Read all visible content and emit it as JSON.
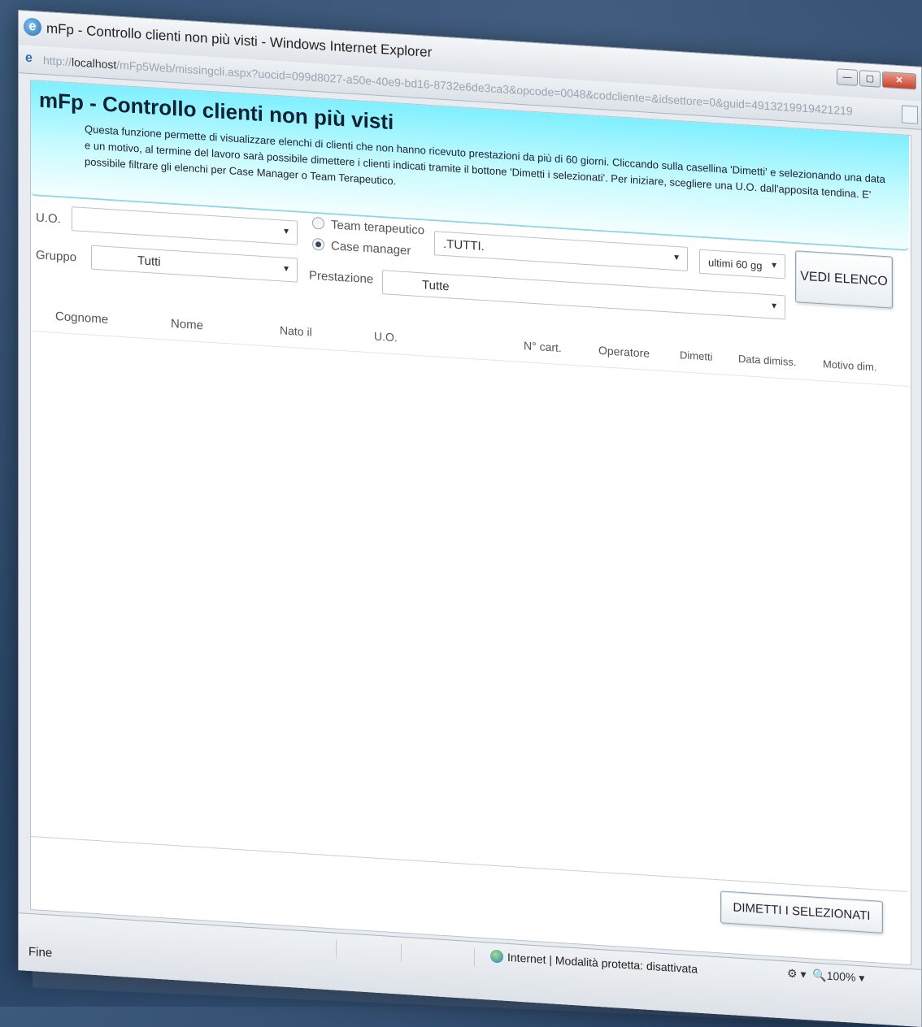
{
  "window": {
    "title": "mFp - Controllo clienti non più visti - Windows Internet Explorer",
    "url_prefix": "http://",
    "url_host": "localhost",
    "url_path": "/mFp5Web/missingcli.aspx?uocid=099d8027-a50e-40e9-bd16-8732e6de3ca3&opcode=0048&codcliente=&idsettore=0&guid=4913219919421219"
  },
  "header": {
    "title": "mFp - Controllo clienti non più visti",
    "description": "Questa funzione permette di visualizzare elenchi di clienti che non hanno ricevuto prestazioni da più di 60 giorni. Cliccando sulla casellina 'Dimetti' e selezionando una data e un motivo, al termine del lavoro sarà possibile dimettere i clienti indicati tramite il bottone 'Dimetti i selezionati'. Per iniziare, scegliere una U.O. dall'apposita tendina. E' possibile filtrare gli elenchi per Case Manager o Team Terapeutico."
  },
  "filters": {
    "uo_label": "U.O.",
    "uo_value": "",
    "gruppo_label": "Gruppo",
    "gruppo_value": "Tutti",
    "radio_team": "Team terapeutico",
    "radio_case": "Case manager",
    "radio_selected": "case_manager",
    "operator_value": ".TUTTI.",
    "prestazione_label": "Prestazione",
    "prestazione_value": "Tutte",
    "period_value": "ultimi 60 gg",
    "vedi_elenco_label": "VEDI ELENCO"
  },
  "grid": {
    "columns": [
      "Cognome",
      "Nome",
      "Nato il",
      "U.O.",
      "N° cart.",
      "Operatore",
      "Dimetti",
      "Data dimiss.",
      "Motivo dim."
    ],
    "rows": []
  },
  "actions": {
    "dimetti_label": "DIMETTI I SELEZIONATI"
  },
  "status": {
    "left": "Fine",
    "zone": "Internet | Modalità protetta: disattivata",
    "zoom": "100%"
  },
  "colors": {
    "header_gradient_top": "#7fefff",
    "header_gradient_bottom": "#f4feff",
    "background": "#2f4b6e"
  }
}
